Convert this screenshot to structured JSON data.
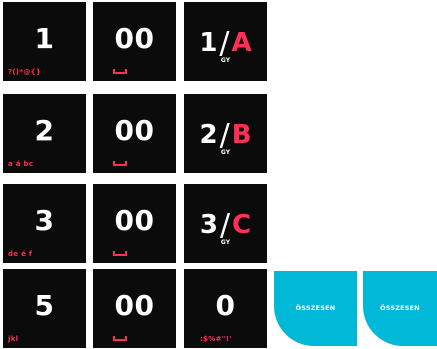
{
  "rows": [
    {
      "digit": "1",
      "digit_sub": "?()*@{}",
      "double_zero": "00",
      "combo_num": "1",
      "combo_sep": "/",
      "combo_letter": "A",
      "combo_sub": "GY"
    },
    {
      "digit": "2",
      "digit_sub": "a á bc",
      "double_zero": "00",
      "combo_num": "2",
      "combo_sep": "/",
      "combo_letter": "B",
      "combo_sub": "GY"
    },
    {
      "digit": "3",
      "digit_sub": "de é f",
      "double_zero": "00",
      "combo_num": "3",
      "combo_sep": "/",
      "combo_letter": "C",
      "combo_sub": "GY"
    },
    {
      "digit": "5",
      "digit_sub": "jkl",
      "double_zero": "00",
      "zero": "0",
      "zero_sub": ":$%#\"!'"
    }
  ],
  "total_label": "ÖSSZESEN",
  "colors": {
    "key_bg": "#0b0b0b",
    "accent": "#ff2f56",
    "total_bg": "#00b8d8"
  },
  "icons": {
    "space": "space-icon"
  }
}
